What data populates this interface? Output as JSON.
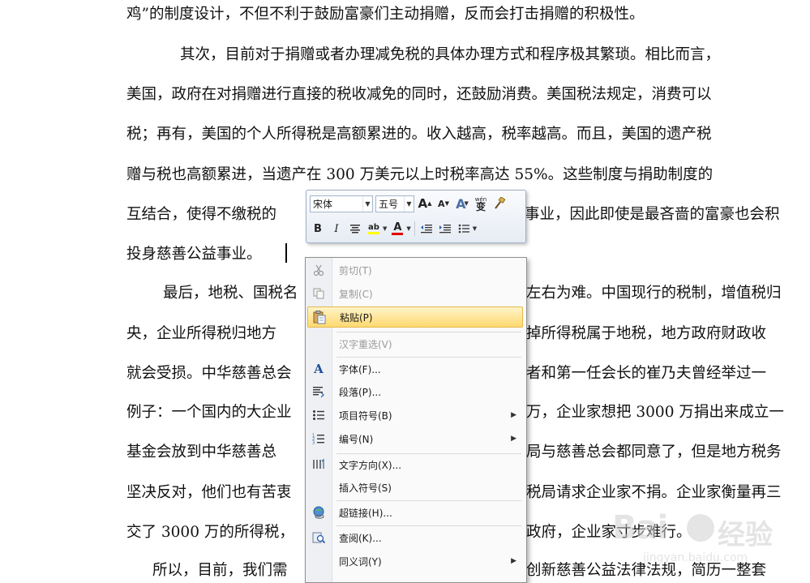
{
  "document": {
    "lines": [
      "鸡”的制度设计，不但不利于鼓励富豪们主动捐赠，反而会打击捐赠的积极性。",
      "其次，目前对于捐赠或者办理减免税的具体办理方式和程序极其繁琐。相比而言，",
      "美国，政府在对捐赠进行直接的税收减免的同时，还鼓励消费。美国税法规定，消费可以",
      "税；再有，美国的个人所得税是高额累进的。收入越高，税率越高。而且，美国的遗产税",
      "赠与税也高额累进，当遗产在 300 万美元以上时税率高达 55%。这些制度与捐助制度的",
      "互结合，使得不缴税的",
      "事业，因此即使是最吝啬的富豪也会积",
      "投身慈善公益事业。",
      "最后，地税、国税名",
      "左右为难。中国现行的税制，增值税归",
      "央，企业所得税归地方",
      "掉所得税属于地税，地方政府财政收",
      "就会受损。中华慈善总会",
      "者和第一任会长的崔乃夫曾经举过一",
      "例子：一个国内的大企业",
      "万，企业家想把 3000 万捐出来成立一",
      "基金会放到中华慈善总",
      "局与慈善总会都同意了，但是地方税务",
      "坚决反对，他们也有苦衷",
      "税局请求企业家不捐。企业家衡量再三",
      "交了 3000 万的所得税，",
      "政府，企业家寸步难行。",
      "所以，目前，我们需",
      "创新慈善公益法律法规，简历一整套"
    ]
  },
  "mini_toolbar": {
    "font_name": "宋体",
    "font_size": "五号",
    "grow_font": "A",
    "shrink_font": "A",
    "styles": "A",
    "phonetic_guide": "wén",
    "phonetic_char": "变",
    "bold": "B",
    "italic": "I",
    "highlight_label": "ab",
    "font_color_label": "A",
    "highlight_color": "#ffff00",
    "font_color": "#e00000"
  },
  "context_menu": {
    "items": [
      {
        "label": "剪切(T)",
        "enabled": false,
        "icon": "scissors-icon"
      },
      {
        "label": "复制(C)",
        "enabled": false,
        "icon": "copy-icon"
      },
      {
        "label": "粘贴(P)",
        "enabled": true,
        "highlighted": true,
        "icon": "paste-icon"
      },
      {
        "label": "汉字重选(V)",
        "enabled": false
      },
      {
        "label": "字体(F)...",
        "enabled": true,
        "icon": "font-icon"
      },
      {
        "label": "段落(P)...",
        "enabled": true,
        "icon": "paragraph-icon"
      },
      {
        "label": "项目符号(B)",
        "enabled": true,
        "submenu": true,
        "icon": "bullets-icon"
      },
      {
        "label": "编号(N)",
        "enabled": true,
        "submenu": true,
        "icon": "numbering-icon"
      },
      {
        "label": "文字方向(X)...",
        "enabled": true,
        "icon": "text-direction-icon"
      },
      {
        "label": "插入符号(S)",
        "enabled": true
      },
      {
        "label": "超链接(H)...",
        "enabled": true,
        "icon": "hyperlink-icon"
      },
      {
        "label": "查阅(K)...",
        "enabled": true,
        "icon": "lookup-icon"
      },
      {
        "label": "同义词(Y)",
        "enabled": true,
        "submenu": true
      }
    ],
    "submenu_arrow": "▶"
  },
  "watermark": {
    "brand": "Bai",
    "brand_cn": "经验",
    "url": "jingyan.baidu.com"
  },
  "colors": {
    "menu_highlight": "#ffd970",
    "disabled_text": "#9a9a9a"
  }
}
